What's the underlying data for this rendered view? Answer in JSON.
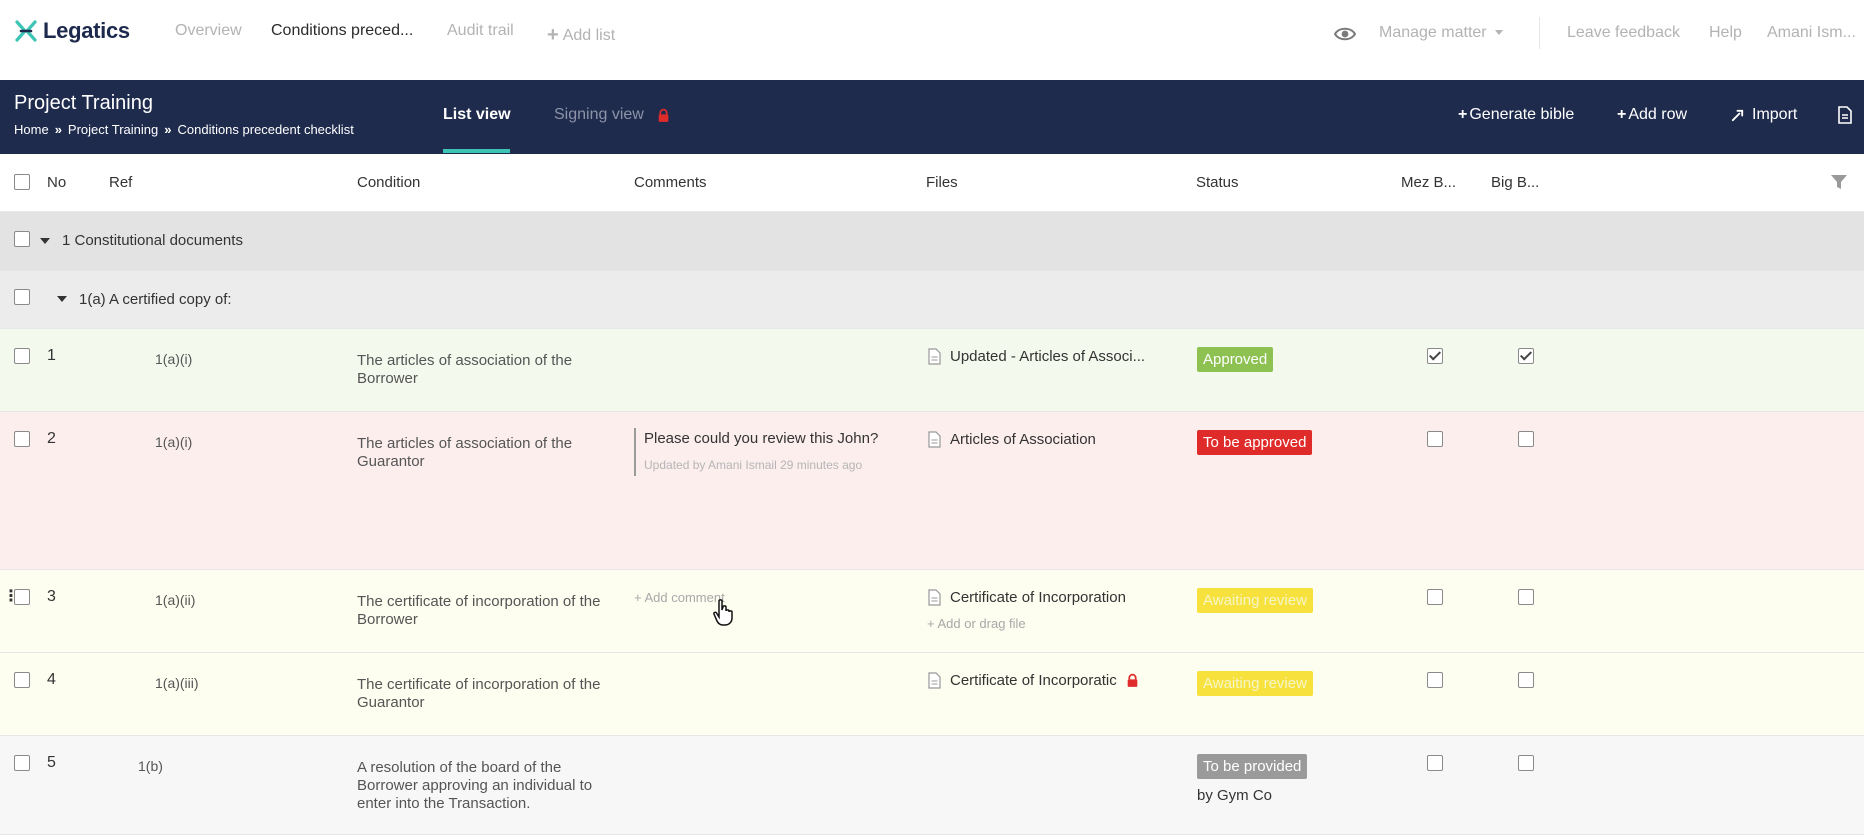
{
  "app": {
    "name": "Legatics",
    "brand_color": "#1f2b4d",
    "accent_color": "#3cc4b4"
  },
  "topnav": {
    "items": [
      "Overview",
      "Conditions preced...",
      "Audit trail",
      "Add list"
    ],
    "right": {
      "manage": "Manage matter",
      "feedback": "Leave feedback",
      "help": "Help",
      "user": "Amani Ism..."
    }
  },
  "header": {
    "title": "Project Training",
    "breadcrumb": [
      "Home",
      "Project Training",
      "Conditions precedent checklist"
    ],
    "tabs": [
      {
        "label": "List view",
        "active": true
      },
      {
        "label": "Signing view",
        "active": false
      }
    ],
    "actions": [
      "Generate bible",
      "Add row",
      "Import"
    ]
  },
  "columns": [
    "No",
    "Ref",
    "Condition",
    "Comments",
    "Files",
    "Status",
    "Mez B...",
    "Big B..."
  ],
  "groups": {
    "g1": "1 Constitutional documents",
    "g1a": "1(a) A certified copy of:"
  },
  "rows": [
    {
      "no": "1",
      "ref": "1(a)(i)",
      "condition": "The articles of association of the Borrower",
      "file": "Updated - Articles of Associ...",
      "status": "Approved",
      "status_color": "#8dc152",
      "mez": true,
      "big": true
    },
    {
      "no": "2",
      "ref": "1(a)(i)",
      "condition": "The articles of association of the Guarantor",
      "comment": "Please could you review this John?",
      "comment_meta": "Updated by Amani Ismail 29 minutes ago",
      "file": "Articles of Association",
      "status": "To be approved",
      "status_color": "#e02b2b",
      "mez": false,
      "big": false
    },
    {
      "no": "3",
      "ref": "1(a)(ii)",
      "condition": "The certificate of incorporation of the Borrower",
      "add_comment": "+ Add comment",
      "file": "Certificate of Incorporation",
      "add_file": "+ Add or drag file",
      "status": "Awaiting review",
      "status_color": "#f7e23d",
      "mez": false,
      "big": false
    },
    {
      "no": "4",
      "ref": "1(a)(iii)",
      "condition": "The certificate of incorporation of the Guarantor",
      "file": "Certificate of Incorporatic",
      "status": "Awaiting review",
      "status_color": "#f7e23d",
      "mez": false,
      "big": false
    },
    {
      "no": "5",
      "ref": "1(b)",
      "condition": "A resolution of the board of the Borrower approving an individual to enter into the Transaction.",
      "status": "To be provided",
      "status_color": "#9a9a9a",
      "status_note": "by Gym Co",
      "mez": false,
      "big": false
    }
  ],
  "icons": [
    "logo-icon",
    "eye-icon",
    "lock-icon",
    "import-icon",
    "export-icon",
    "filter-icon",
    "file-icon",
    "hand-cursor-icon"
  ]
}
